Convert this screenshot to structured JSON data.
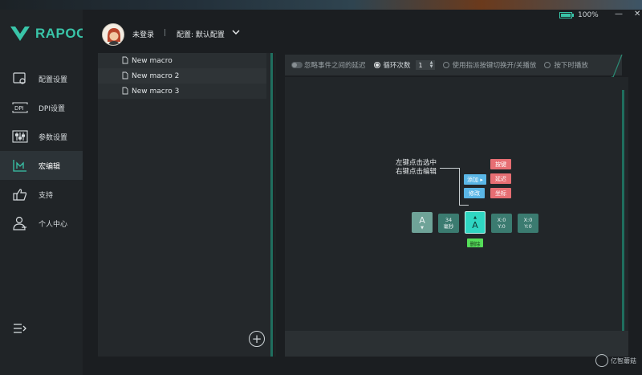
{
  "app": {
    "logo_text": "RAPOO",
    "battery": {
      "percent_label": "100%",
      "level": 100
    },
    "window_buttons": {
      "minimize": "—",
      "close": "✕"
    }
  },
  "header": {
    "user_name": "未登录",
    "separator": "|",
    "config_label": "配置: 默认配置"
  },
  "sidebar": {
    "items": [
      {
        "label": "配置设置",
        "icon": "config-icon"
      },
      {
        "label": "DPI设置",
        "icon": "dpi-icon"
      },
      {
        "label": "参数设置",
        "icon": "sliders-icon"
      },
      {
        "label": "宏编辑",
        "icon": "macro-icon",
        "active": true
      },
      {
        "label": "支持",
        "icon": "thumbs-up-icon"
      },
      {
        "label": "个人中心",
        "icon": "user-icon"
      }
    ]
  },
  "macros": {
    "items": [
      "New macro",
      "New macro 2",
      "New macro 3"
    ],
    "add_label": "+"
  },
  "toolbar": {
    "ignore_delay": "忽略事件之间的延迟",
    "loop_count_label": "循环次数",
    "loop_count_value": "1",
    "toggle_play": "使用指派按键切换开/关播放",
    "hold_play": "按下时播放"
  },
  "tutorial": {
    "hint_line1": "左键点击选中",
    "hint_line2": "右键点击编辑",
    "add": "添加",
    "modify": "修改",
    "key": "按键",
    "delay": "延迟",
    "coord": "坐标",
    "delete": "删除",
    "key_a": "A",
    "delay_value": "34",
    "delay_unit": "毫秒",
    "x_label": "X:0",
    "y_label": "Y:0"
  },
  "watermark": "亿智蘑菇",
  "colors": {
    "accent": "#39c4a8",
    "blue": "#5ab6e6",
    "red": "#e76e73",
    "green": "#55dd59"
  }
}
